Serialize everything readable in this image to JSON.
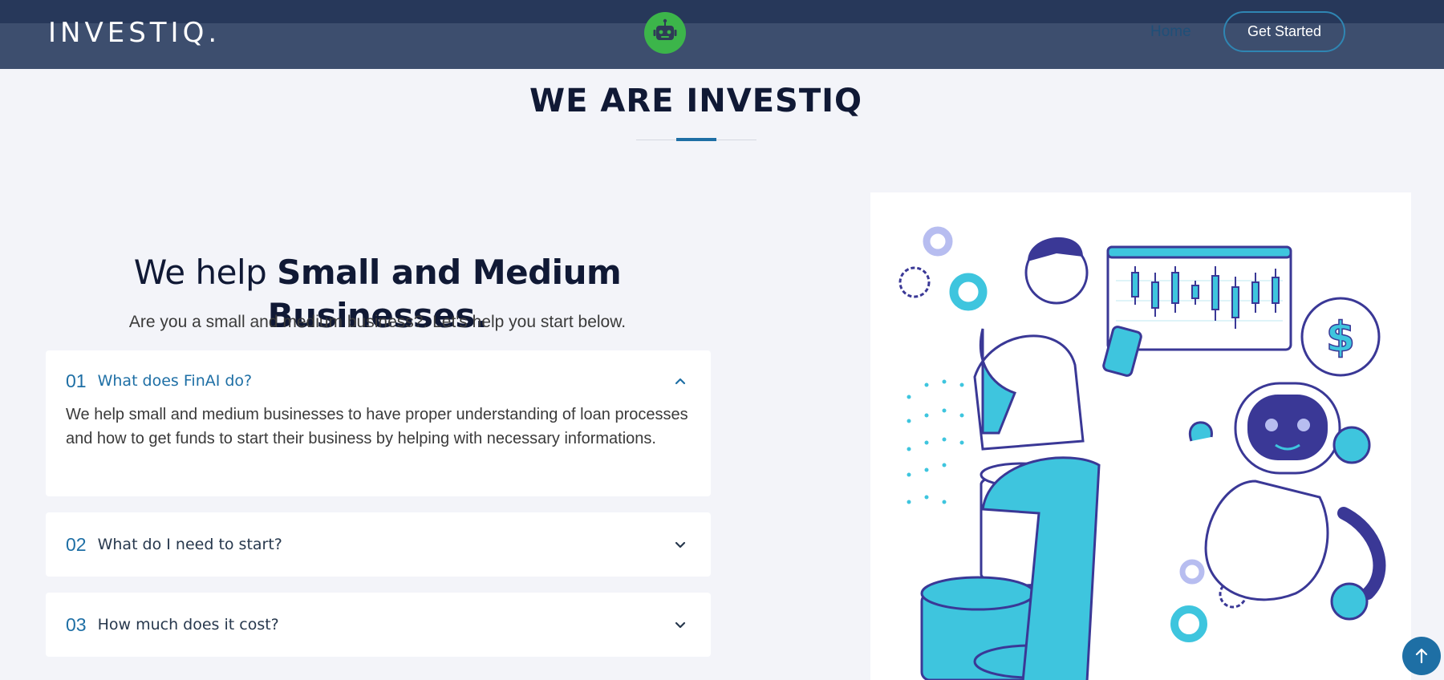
{
  "header": {
    "logo": "INVESTIQ.",
    "nav": {
      "home_label": "Home"
    },
    "cta_label": "Get Started",
    "bot_icon": "robot-icon"
  },
  "section": {
    "title": "WE ARE INVESTIQ"
  },
  "hero": {
    "headline_normal": "We help ",
    "headline_bold": "Small and Medium Businesses.",
    "subline": "Are you a small and medium business?. Let's help you start below."
  },
  "faq": [
    {
      "number": "01",
      "question": "What does FinAI do?",
      "answer": "We help small and medium businesses to have proper understanding of loan processes and how to get funds to start their business by helping with necessary informations.",
      "expanded": true
    },
    {
      "number": "02",
      "question": "What do I need to start?",
      "expanded": false
    },
    {
      "number": "03",
      "question": "How much does it cost?",
      "expanded": false
    }
  ],
  "illustration": {
    "subject": "person-with-phone-robot-and-coins-illustration"
  },
  "colors": {
    "header_bg": "#3d4e6e",
    "header_strip": "#27385a",
    "accent_blue": "#1e6fa5",
    "bot_green": "#3cb54a",
    "page_bg": "#f3f4f9",
    "illus_cyan": "#3ec5de",
    "illus_navy": "#3a3896"
  },
  "icons": {
    "chevron_up": "chevron-up-icon",
    "chevron_down": "chevron-down-icon",
    "scroll_top": "arrow-up-icon"
  }
}
